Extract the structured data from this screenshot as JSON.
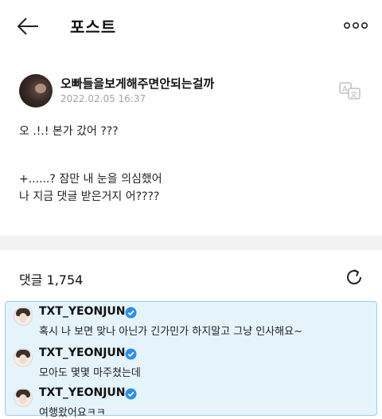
{
  "header": {
    "title": "포스트",
    "back_icon": "arrow-left-icon",
    "more_icon": "more-dots-icon"
  },
  "post": {
    "author": "오빠들을보게해주면안되는걸까",
    "timestamp": "2022.02.05 16:37",
    "translate_icon": "translate-icon",
    "lines": [
      "오 .!.! 본가 갔어 ???",
      "+......? 잠만 내 눈을 의심했어",
      "나 지금 댓글 받은거지 어????"
    ]
  },
  "comments": {
    "count_label": "댓글 1,754",
    "refresh_icon": "refresh-icon",
    "highlight_color": "#e5f3fb",
    "items": [
      {
        "name": "TXT_YEONJUN",
        "text": "혹시 나 보면 맞나 아닌가 긴가민가 하지말고 그냥 인사해요~"
      },
      {
        "name": "TXT_YEONJUN",
        "text": "모아도 몇몇 마주쳤는데"
      },
      {
        "name": "TXT_YEONJUN",
        "text": "여행왔어요ㅋㅋ"
      }
    ]
  },
  "colors": {
    "verified": "#2f8fe8",
    "timestamp": "#a3a3a3",
    "divider": "#f1f2f4"
  }
}
